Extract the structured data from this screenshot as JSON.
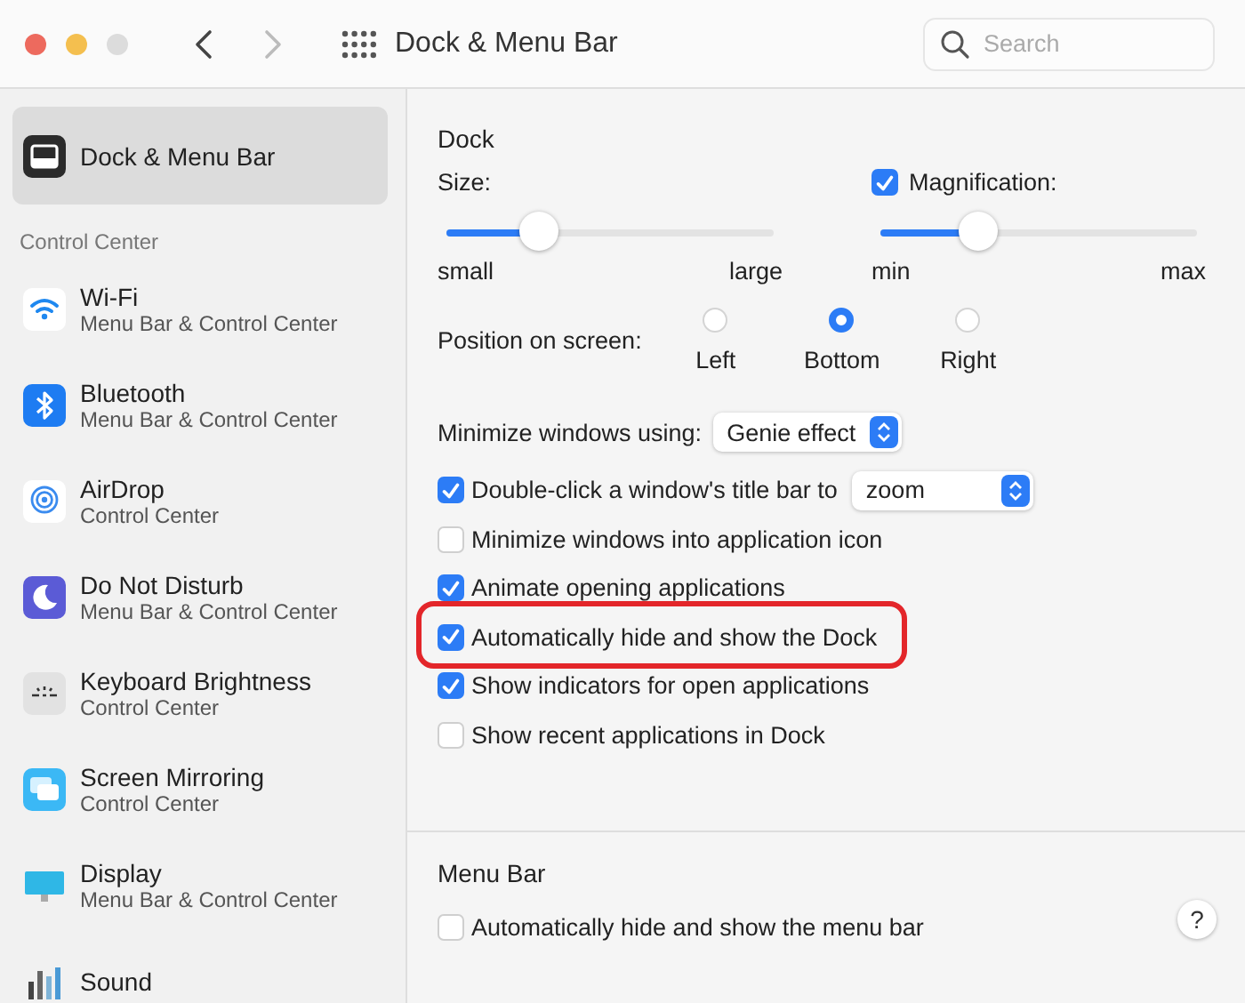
{
  "window": {
    "title": "Dock & Menu Bar",
    "back_enabled": true,
    "forward_enabled": false
  },
  "search": {
    "placeholder": "Search"
  },
  "sidebar": {
    "top_items": [
      {
        "label": "Dock & Menu Bar",
        "selected": true
      }
    ],
    "section": "Control Center",
    "items": [
      {
        "label": "Wi-Fi",
        "sublabel": "Menu Bar & Control Center",
        "selected": false
      },
      {
        "label": "Bluetooth",
        "sublabel": "Menu Bar & Control Center",
        "selected": false
      },
      {
        "label": "AirDrop",
        "sublabel": "Control Center",
        "selected": false
      },
      {
        "label": "Do Not Disturb",
        "sublabel": "Menu Bar & Control Center",
        "selected": false
      },
      {
        "label": "Keyboard Brightness",
        "sublabel": "Control Center",
        "selected": false
      },
      {
        "label": "Screen Mirroring",
        "sublabel": "Control Center",
        "selected": false
      },
      {
        "label": "Display",
        "sublabel": "Menu Bar & Control Center",
        "selected": false
      },
      {
        "label": "Sound",
        "selected": false
      }
    ]
  },
  "dock": {
    "heading": "Dock",
    "size": {
      "label": "Size:",
      "level": 0.28,
      "min_label": "small",
      "max_label": "large"
    },
    "magnification": {
      "label": "Magnification:",
      "checked": true,
      "level": 0.31,
      "min_label": "min",
      "max_label": "max"
    },
    "position": {
      "label": "Position on screen:",
      "options": [
        {
          "label": "Left",
          "selected": false
        },
        {
          "label": "Bottom",
          "selected": true
        },
        {
          "label": "Right",
          "selected": false
        }
      ]
    },
    "minimize": {
      "label": "Minimize windows using:",
      "value": "Genie effect"
    },
    "options": [
      {
        "label": "Double-click a window's title bar to",
        "checked": true,
        "dropdown": "zoom",
        "highlighted": false
      },
      {
        "label": "Minimize windows into application icon",
        "checked": false,
        "highlighted": false
      },
      {
        "label": "Animate opening applications",
        "checked": true,
        "highlighted": false
      },
      {
        "label": "Automatically hide and show the Dock",
        "checked": true,
        "highlighted": true
      },
      {
        "label": "Show indicators for open applications",
        "checked": true,
        "highlighted": false
      },
      {
        "label": "Show recent applications in Dock",
        "checked": false,
        "highlighted": false
      }
    ]
  },
  "menu_bar": {
    "heading": "Menu Bar",
    "options": [
      {
        "label": "Automatically hide and show the menu bar",
        "checked": false
      }
    ]
  },
  "help": "?"
}
